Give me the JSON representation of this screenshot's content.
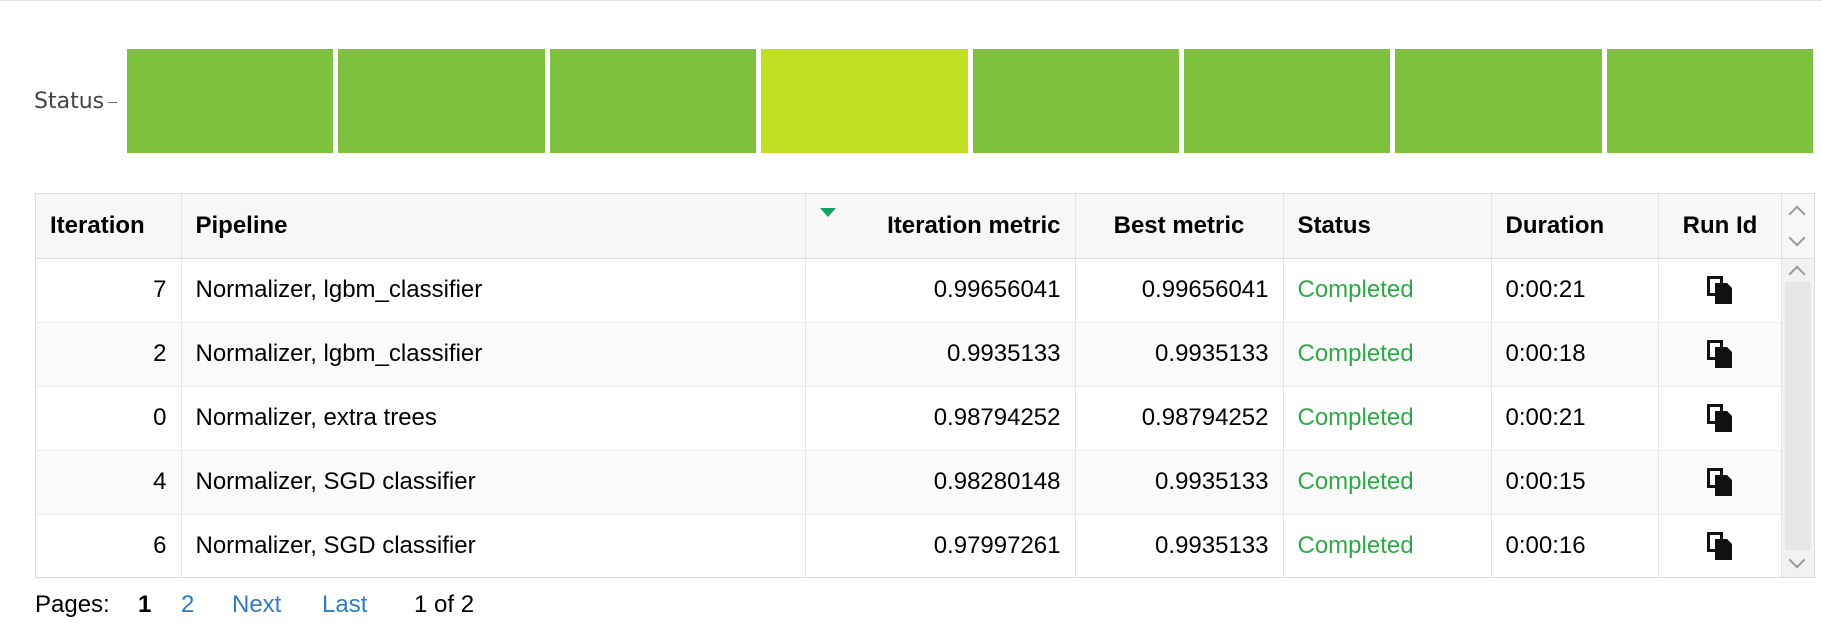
{
  "status_strip": {
    "label": "Status",
    "cells": [
      {
        "status": "completed",
        "color": "#7ec13f"
      },
      {
        "status": "completed",
        "color": "#7ec13f"
      },
      {
        "status": "completed",
        "color": "#7ec13f"
      },
      {
        "status": "completed",
        "color": "#c1df22"
      },
      {
        "status": "completed",
        "color": "#7ec13f"
      },
      {
        "status": "completed",
        "color": "#7ec13f"
      },
      {
        "status": "completed",
        "color": "#7ec13f"
      },
      {
        "status": "completed",
        "color": "#7ec13f"
      }
    ]
  },
  "table": {
    "columns": {
      "iteration": "Iteration",
      "pipeline": "Pipeline",
      "iteration_metric": "Iteration metric",
      "best_metric": "Best metric",
      "status": "Status",
      "duration": "Duration",
      "run_id": "Run Id"
    },
    "sorted_column": "iteration_metric",
    "sort_direction": "descending",
    "rows": [
      {
        "iteration": "7",
        "pipeline": "Normalizer, lgbm_classifier",
        "iteration_metric": "0.99656041",
        "best_metric": "0.99656041",
        "status": "Completed",
        "duration": "0:00:21",
        "run_id_icon": "copy-icon"
      },
      {
        "iteration": "2",
        "pipeline": "Normalizer, lgbm_classifier",
        "iteration_metric": "0.9935133",
        "best_metric": "0.9935133",
        "status": "Completed",
        "duration": "0:00:18",
        "run_id_icon": "copy-icon"
      },
      {
        "iteration": "0",
        "pipeline": "Normalizer, extra trees",
        "iteration_metric": "0.98794252",
        "best_metric": "0.98794252",
        "status": "Completed",
        "duration": "0:00:21",
        "run_id_icon": "copy-icon"
      },
      {
        "iteration": "4",
        "pipeline": "Normalizer, SGD classifier",
        "iteration_metric": "0.98280148",
        "best_metric": "0.9935133",
        "status": "Completed",
        "duration": "0:00:15",
        "run_id_icon": "copy-icon"
      },
      {
        "iteration": "6",
        "pipeline": "Normalizer, SGD classifier",
        "iteration_metric": "0.97997261",
        "best_metric": "0.9935133",
        "status": "Completed",
        "duration": "0:00:16",
        "run_id_icon": "copy-icon"
      }
    ]
  },
  "pager": {
    "label": "Pages:",
    "current": "1",
    "page_2": "2",
    "next": "Next",
    "last": "Last",
    "summary": "1 of 2"
  },
  "colors": {
    "completed_text": "#2fa84a",
    "link": "#2f7bc4",
    "sort_indicator": "#14a06a"
  }
}
